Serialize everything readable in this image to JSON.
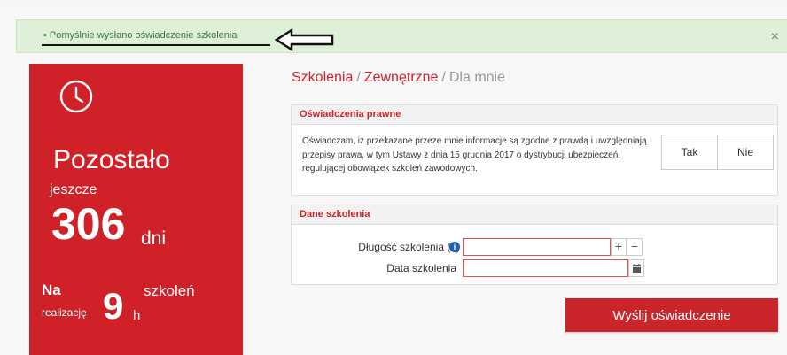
{
  "alert": {
    "message": "• Pomyślnie wysłano oświadczenie szkolenia",
    "close_label": "×"
  },
  "left_panel": {
    "clock_icon": "clock-icon",
    "remaining_label": "Pozostało",
    "still_label": "jeszcze",
    "days_value": "306",
    "days_unit": "dni",
    "na_label": "Na",
    "realization_label": "realizację",
    "hours_value": "9",
    "hours_unit": "h",
    "trainings_label": "szkoleń"
  },
  "breadcrumb": {
    "items": [
      "Szkolenia",
      "Zewnętrzne"
    ],
    "separator": "/",
    "current": "Dla mnie"
  },
  "legal": {
    "title": "Oświadczenia prawne",
    "text": "Oświadczam, iż przekazane przeze mnie informacje są zgodne z prawdą i uwzględniają przepisy prawa, w tym Ustawy z dnia 15 grudnia 2017 o dystrybucji ubezpieczeń, regulującej obowiązek szkoleń zawodowych.",
    "yes_label": "Tak",
    "no_label": "Nie"
  },
  "training": {
    "title": "Dane szkolenia",
    "length_label": "Długość szkolenia (h)",
    "length_value": "",
    "info_icon": "i",
    "plus_label": "+",
    "minus_label": "−",
    "date_label": "Data szkolenia",
    "date_value": ""
  },
  "submit_label": "Wyślij oświadczenie",
  "colors": {
    "accent": "#c9252b",
    "panel": "#cf2127",
    "alert_bg": "#dff0d8",
    "alert_text": "#3c763d"
  }
}
